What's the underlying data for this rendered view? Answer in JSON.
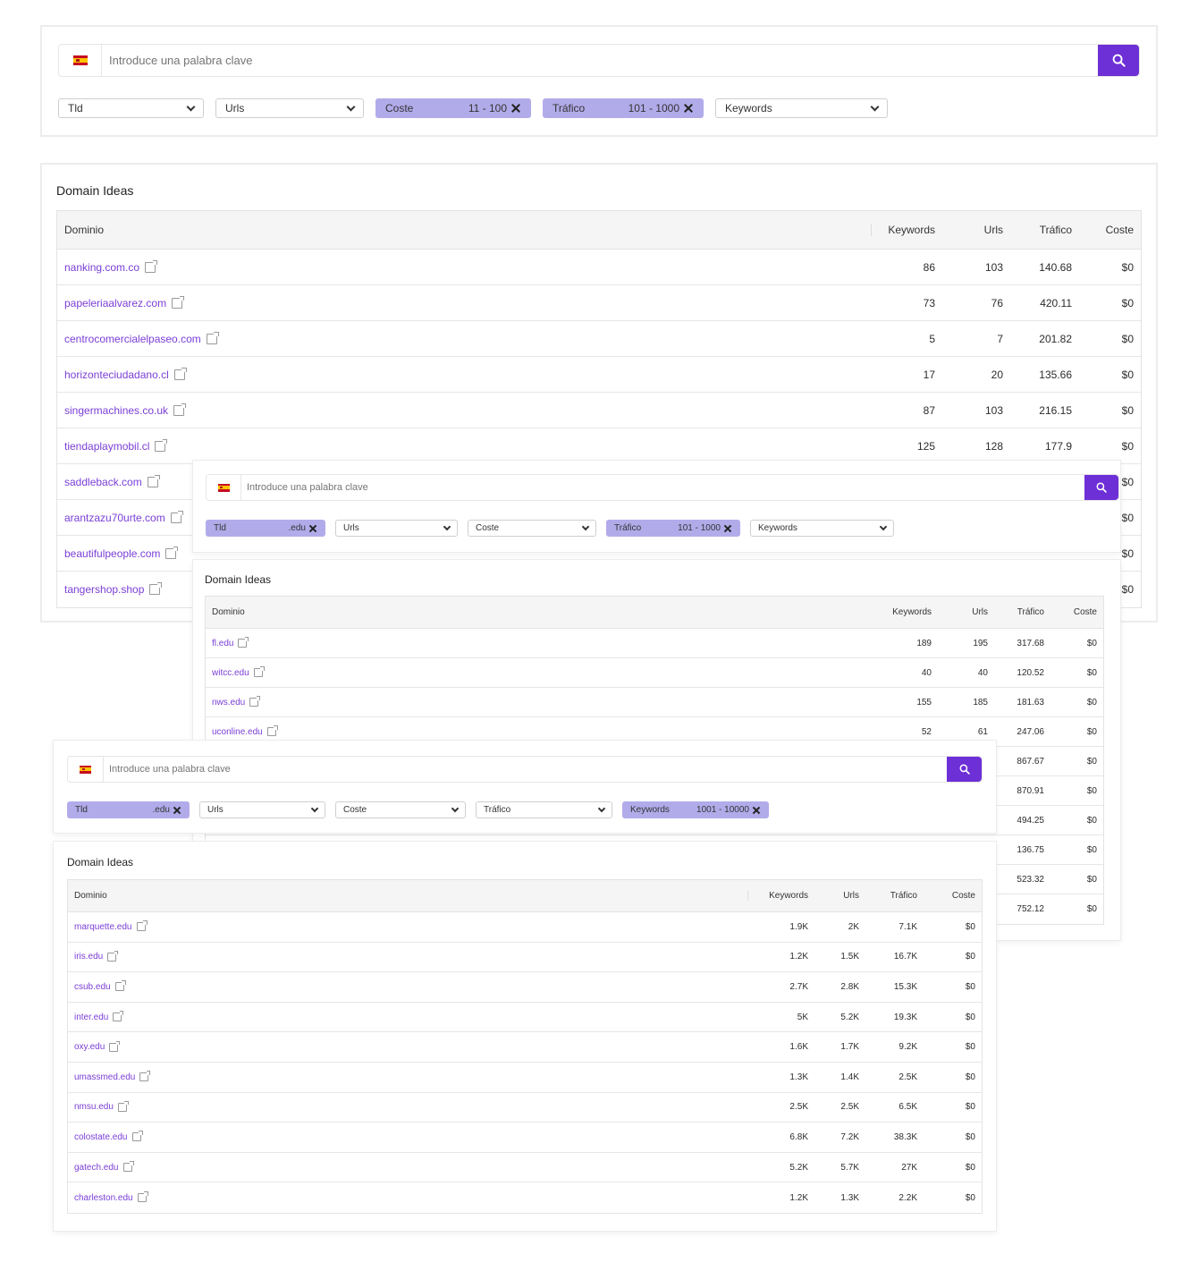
{
  "search": {
    "placeholder": "Introduce una palabra clave"
  },
  "panel_title": "Domain Ideas",
  "columns": {
    "dominio": "Dominio",
    "keywords": "Keywords",
    "urls": "Urls",
    "trafico": "Tráfico",
    "coste": "Coste"
  },
  "screens": [
    {
      "filters": [
        {
          "label": "Tld",
          "value": "",
          "active": false
        },
        {
          "label": "Urls",
          "value": "",
          "active": false
        },
        {
          "label": "Coste",
          "value": "11 - 100",
          "active": true
        },
        {
          "label": "Tráfico",
          "value": "101 - 1000",
          "active": true
        },
        {
          "label": "Keywords",
          "value": "",
          "active": false
        }
      ],
      "rows": [
        {
          "domain": "nanking.com.co",
          "keywords": "86",
          "urls": "103",
          "trafico": "140.68",
          "coste": "$0"
        },
        {
          "domain": "papeleriaalvarez.com",
          "keywords": "73",
          "urls": "76",
          "trafico": "420.11",
          "coste": "$0"
        },
        {
          "domain": "centrocomercialelpaseo.com",
          "keywords": "5",
          "urls": "7",
          "trafico": "201.82",
          "coste": "$0"
        },
        {
          "domain": "horizonteciudadano.cl",
          "keywords": "17",
          "urls": "20",
          "trafico": "135.66",
          "coste": "$0"
        },
        {
          "domain": "singermachines.co.uk",
          "keywords": "87",
          "urls": "103",
          "trafico": "216.15",
          "coste": "$0"
        },
        {
          "domain": "tiendaplaymobil.cl",
          "keywords": "125",
          "urls": "128",
          "trafico": "177.9",
          "coste": "$0"
        },
        {
          "domain": "saddleback.com",
          "keywords": "",
          "urls": "",
          "trafico": "",
          "coste": "$0"
        },
        {
          "domain": "arantzazu70urte.com",
          "keywords": "",
          "urls": "",
          "trafico": "",
          "coste": "$0"
        },
        {
          "domain": "beautifulpeople.com",
          "keywords": "",
          "urls": "",
          "trafico": "",
          "coste": "$0"
        },
        {
          "domain": "tangershop.shop",
          "keywords": "",
          "urls": "",
          "trafico": "",
          "coste": "$0"
        }
      ]
    },
    {
      "filters": [
        {
          "label": "Tld",
          "value": ".edu",
          "active": true
        },
        {
          "label": "Urls",
          "value": "",
          "active": false
        },
        {
          "label": "Coste",
          "value": "",
          "active": false
        },
        {
          "label": "Tráfico",
          "value": "101 - 1000",
          "active": true
        },
        {
          "label": "Keywords",
          "value": "",
          "active": false
        }
      ],
      "rows": [
        {
          "domain": "fl.edu",
          "keywords": "189",
          "urls": "195",
          "trafico": "317.68",
          "coste": "$0"
        },
        {
          "domain": "witcc.edu",
          "keywords": "40",
          "urls": "40",
          "trafico": "120.52",
          "coste": "$0"
        },
        {
          "domain": "nws.edu",
          "keywords": "155",
          "urls": "185",
          "trafico": "181.63",
          "coste": "$0"
        },
        {
          "domain": "uconline.edu",
          "keywords": "52",
          "urls": "61",
          "trafico": "247.06",
          "coste": "$0"
        },
        {
          "domain": "",
          "keywords": "",
          "urls": "",
          "trafico": "867.67",
          "coste": "$0"
        },
        {
          "domain": "",
          "keywords": "",
          "urls": "",
          "trafico": "870.91",
          "coste": "$0"
        },
        {
          "domain": "",
          "keywords": "",
          "urls": "",
          "trafico": "494.25",
          "coste": "$0"
        },
        {
          "domain": "",
          "keywords": "",
          "urls": "",
          "trafico": "136.75",
          "coste": "$0"
        },
        {
          "domain": "",
          "keywords": "",
          "urls": "",
          "trafico": "523.32",
          "coste": "$0"
        },
        {
          "domain": "",
          "keywords": "",
          "urls": "",
          "trafico": "752.12",
          "coste": "$0"
        }
      ]
    },
    {
      "filters": [
        {
          "label": "Tld",
          "value": ".edu",
          "active": true
        },
        {
          "label": "Urls",
          "value": "",
          "active": false
        },
        {
          "label": "Coste",
          "value": "",
          "active": false
        },
        {
          "label": "Tráfico",
          "value": "",
          "active": false
        },
        {
          "label": "Keywords",
          "value": "1001 - 10000",
          "active": true
        }
      ],
      "rows": [
        {
          "domain": "marquette.edu",
          "keywords": "1.9K",
          "urls": "2K",
          "trafico": "7.1K",
          "coste": "$0"
        },
        {
          "domain": "iris.edu",
          "keywords": "1.2K",
          "urls": "1.5K",
          "trafico": "16.7K",
          "coste": "$0"
        },
        {
          "domain": "csub.edu",
          "keywords": "2.7K",
          "urls": "2.8K",
          "trafico": "15.3K",
          "coste": "$0"
        },
        {
          "domain": "inter.edu",
          "keywords": "5K",
          "urls": "5.2K",
          "trafico": "19.3K",
          "coste": "$0"
        },
        {
          "domain": "oxy.edu",
          "keywords": "1.6K",
          "urls": "1.7K",
          "trafico": "9.2K",
          "coste": "$0"
        },
        {
          "domain": "umassmed.edu",
          "keywords": "1.3K",
          "urls": "1.4K",
          "trafico": "2.5K",
          "coste": "$0"
        },
        {
          "domain": "nmsu.edu",
          "keywords": "2.5K",
          "urls": "2.5K",
          "trafico": "6.5K",
          "coste": "$0"
        },
        {
          "domain": "colostate.edu",
          "keywords": "6.8K",
          "urls": "7.2K",
          "trafico": "38.3K",
          "coste": "$0"
        },
        {
          "domain": "gatech.edu",
          "keywords": "5.2K",
          "urls": "5.7K",
          "trafico": "27K",
          "coste": "$0"
        },
        {
          "domain": "charleston.edu",
          "keywords": "1.2K",
          "urls": "1.3K",
          "trafico": "2.2K",
          "coste": "$0"
        }
      ]
    }
  ]
}
